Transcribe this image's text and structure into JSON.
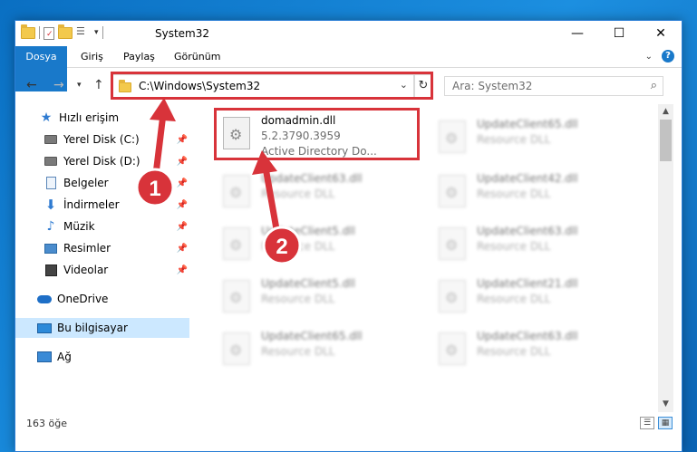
{
  "window": {
    "title": "System32"
  },
  "ribbon": {
    "tabs": [
      {
        "label": "Dosya"
      },
      {
        "label": "Giriş"
      },
      {
        "label": "Paylaş"
      },
      {
        "label": "Görünüm"
      }
    ]
  },
  "address": {
    "path": "C:\\Windows\\System32"
  },
  "search": {
    "placeholder": "Ara: System32"
  },
  "sidebar": {
    "quick_access": "Hızlı erişim",
    "items": [
      {
        "label": "Yerel Disk (C:)",
        "icon": "drive-icon",
        "pinned": true
      },
      {
        "label": "Yerel Disk (D:)",
        "icon": "drive-icon",
        "pinned": true
      },
      {
        "label": "Belgeler",
        "icon": "document-icon",
        "pinned": true
      },
      {
        "label": "İndirmeler",
        "icon": "download-icon",
        "pinned": true
      },
      {
        "label": "Müzik",
        "icon": "music-icon",
        "pinned": true
      },
      {
        "label": "Resimler",
        "icon": "pictures-icon",
        "pinned": true
      },
      {
        "label": "Videolar",
        "icon": "videos-icon",
        "pinned": true
      }
    ],
    "onedrive": "OneDrive",
    "this_pc": "Bu bilgisayar",
    "network": "Ağ"
  },
  "files": [
    {
      "name": "domadmin.dll",
      "version": "5.2.3790.3959",
      "description": "Active Directory Do..."
    },
    {
      "name": "UpdateClient65.dll",
      "description": "Resource DLL"
    },
    {
      "name": "UpdateClient63.dll",
      "description": "Resource DLL"
    },
    {
      "name": "UpdateClient42.dll",
      "description": "Resource DLL"
    },
    {
      "name": "UpdateClient5.dll",
      "description": "Resource DLL"
    },
    {
      "name": "UpdateClient63.dll",
      "description": "Resource DLL"
    },
    {
      "name": "UpdateClient5.dll",
      "description": "Resource DLL"
    },
    {
      "name": "UpdateClient21.dll",
      "description": "Resource DLL"
    },
    {
      "name": "UpdateClient65.dll",
      "description": "Resource DLL"
    },
    {
      "name": "UpdateClient63.dll",
      "description": "Resource DLL"
    }
  ],
  "status": {
    "count": "163 öğe"
  },
  "annotations": {
    "badge1": "1",
    "badge2": "2",
    "color": "#d8333a"
  }
}
